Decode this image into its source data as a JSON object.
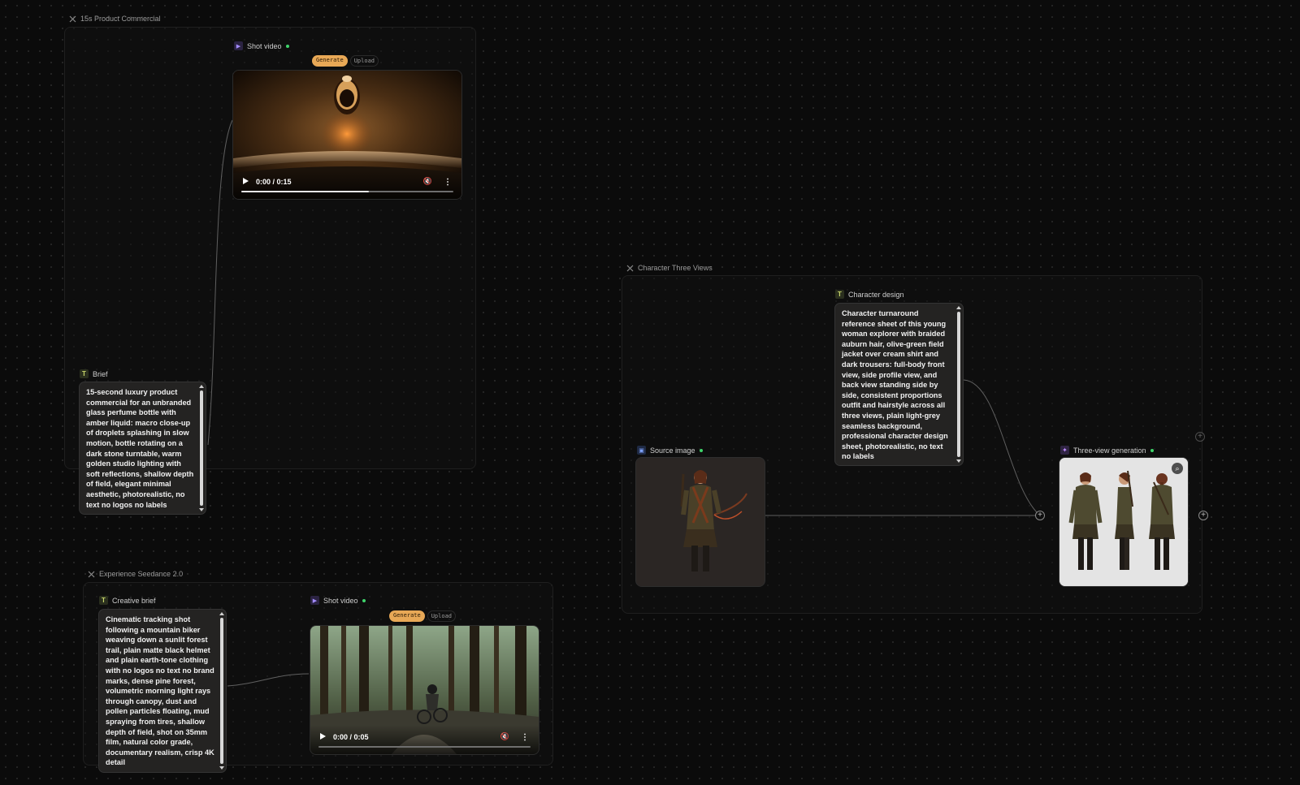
{
  "groups": {
    "product": {
      "title": "15s Product Commercial"
    },
    "character": {
      "title": "Character Three Views"
    },
    "seedance": {
      "title": "Experience Seedance 2.0"
    }
  },
  "nodes": {
    "product_video": {
      "label": "Shot video",
      "tabs": {
        "generate": "Generate",
        "upload": "Upload"
      },
      "time": "0:00 / 0:15",
      "progress": 0.6
    },
    "brief": {
      "label": "Brief",
      "text": "15-second luxury product commercial for an unbranded glass perfume bottle with amber liquid: macro close-up of droplets splashing in slow motion, bottle rotating on a dark stone turntable, warm golden studio lighting with soft reflections, shallow depth of field, elegant minimal aesthetic, photorealistic, no text no logos no labels"
    },
    "character_design": {
      "label": "Character design",
      "text": "Character turnaround reference sheet of this young woman explorer with braided auburn hair, olive-green field jacket over cream shirt and dark trousers: full-body front view, side profile view, and back view standing side by side, consistent proportions outfit and hairstyle across all three views, plain light-grey seamless background, professional character design sheet, photorealistic, no text no labels"
    },
    "source_image": {
      "label": "Source image"
    },
    "three_view": {
      "label": "Three-view generation"
    },
    "creative_brief": {
      "label": "Creative brief",
      "text": "Cinematic tracking shot following a mountain biker weaving down a sunlit forest trail, plain matte black helmet and plain earth-tone clothing with no logos no text no brand marks, dense pine forest, volumetric morning light rays through canopy, dust and pollen particles floating, mud spraying from tires, shallow depth of field, shot on 35mm film, natural color grade, documentary realism, crisp 4K detail"
    },
    "seedance_video": {
      "label": "Shot video",
      "tabs": {
        "generate": "Generate",
        "upload": "Upload"
      },
      "time": "0:00 / 0:05",
      "progress": 0.0
    }
  },
  "colors": {
    "accent": "#e8a856",
    "status_ok": "#3fd46b",
    "canvas": "#0b0b0b"
  },
  "icons": {
    "group": "group-collapse-icon",
    "text_node": "text-node-icon",
    "video_node": "video-node-icon",
    "image_node": "image-node-icon",
    "generation_node": "sparkle-icon"
  }
}
